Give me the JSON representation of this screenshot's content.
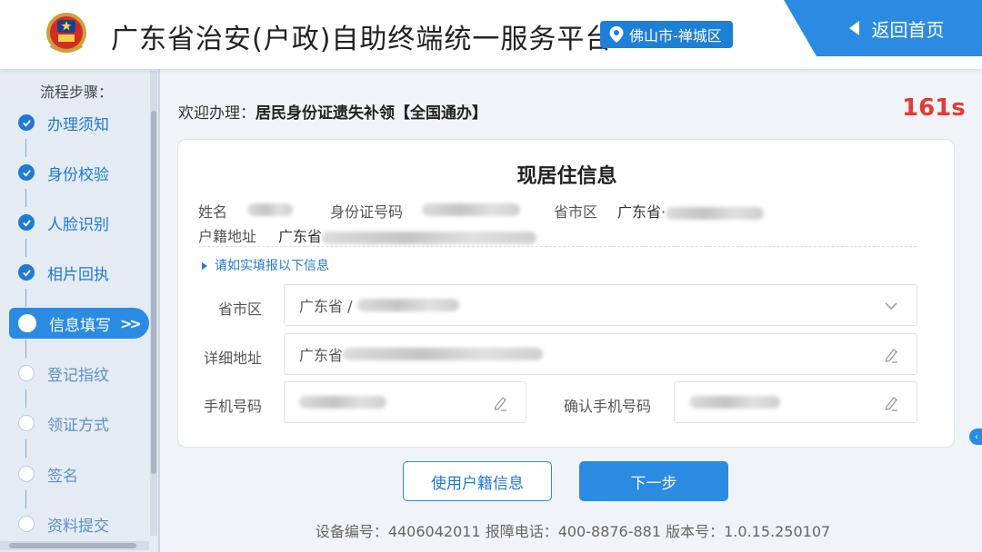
{
  "header": {
    "title": "广东省治安(户政)自助终端统一服务平台",
    "location": "佛山市-禅城区",
    "back_label": "返回首页"
  },
  "sidebar": {
    "heading": "流程步骤：",
    "steps": [
      {
        "label": "办理须知",
        "status": "done"
      },
      {
        "label": "身份校验",
        "status": "done"
      },
      {
        "label": "人脸识别",
        "status": "done"
      },
      {
        "label": "相片回执",
        "status": "done"
      },
      {
        "label": "信息填写",
        "status": "active"
      },
      {
        "label": "登记指纹",
        "status": "todo"
      },
      {
        "label": "领证方式",
        "status": "todo"
      },
      {
        "label": "签名",
        "status": "todo"
      },
      {
        "label": "资料提交",
        "status": "todo"
      }
    ]
  },
  "main": {
    "welcome_prefix": "欢迎办理：",
    "service_name": "居民身份证遗失补领【全国通办】",
    "countdown": "161s",
    "card": {
      "title": "现居住信息",
      "name_label": "姓名",
      "id_label": "身份证号码",
      "region_label": "省市区",
      "region_value": "广东省·",
      "household_label": "户籍地址",
      "household_value": "广东省",
      "hint": "请如实填报以下信息",
      "form": {
        "region_label": "省市区",
        "region_value": "广东省 /",
        "address_label": "详细地址",
        "address_value": "广东省",
        "phone_label": "手机号码",
        "confirm_phone_label": "确认手机号码"
      }
    },
    "use_household_label": "使用户籍信息",
    "next_label": "下一步"
  },
  "footer": {
    "text": "设备编号：4406042011   报障电话：400-8876-881   版本号：1.0.15.250107"
  },
  "colors": {
    "accent": "#2b8be3",
    "countdown": "#e23b3b",
    "sidebar_bg": "#e4ebf3"
  }
}
